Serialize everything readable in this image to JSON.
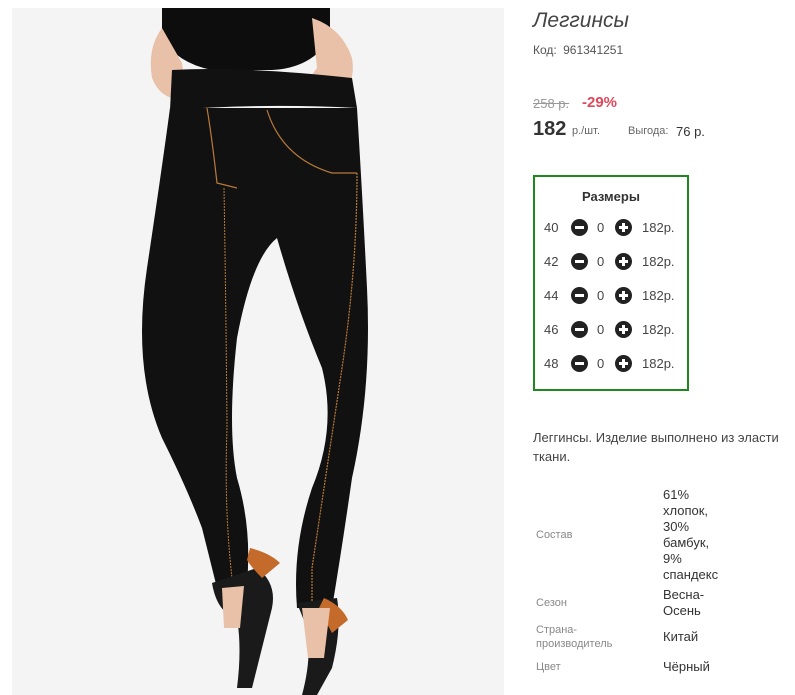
{
  "product": {
    "title": "Леггинсы",
    "code_label": "Код:",
    "code": "961341251",
    "old_price": "258 р.",
    "discount": "-29%",
    "price": "182",
    "unit": "р./шт.",
    "benefit_label": "Выгода:",
    "benefit_value": "76 р."
  },
  "sizes": {
    "title": "Размеры",
    "rows": [
      {
        "size": "40",
        "qty": "0",
        "price": "182р."
      },
      {
        "size": "42",
        "qty": "0",
        "price": "182р."
      },
      {
        "size": "44",
        "qty": "0",
        "price": "182р."
      },
      {
        "size": "46",
        "qty": "0",
        "price": "182р."
      },
      {
        "size": "48",
        "qty": "0",
        "price": "182р."
      }
    ]
  },
  "description": {
    "line1": "Леггинсы. Изделие выполнено из эласти",
    "line2": "ткани."
  },
  "specs": {
    "composition_label": "Состав",
    "composition_lines": [
      "61%",
      "хлопок,",
      "30%",
      "бамбук,",
      "9%",
      "спандекс"
    ],
    "season_label": "Сезон",
    "season_lines": [
      "Весна-",
      "Осень"
    ],
    "country_label_lines": [
      "Страна-",
      "производитель"
    ],
    "country_value": "Китай",
    "color_label": "Цвет",
    "color_value": "Чёрный"
  },
  "colors": {
    "accent_red": "#e0475c",
    "sizes_border": "#1e8a1e",
    "leggings": "#111111",
    "stitching": "#b97a3a"
  }
}
